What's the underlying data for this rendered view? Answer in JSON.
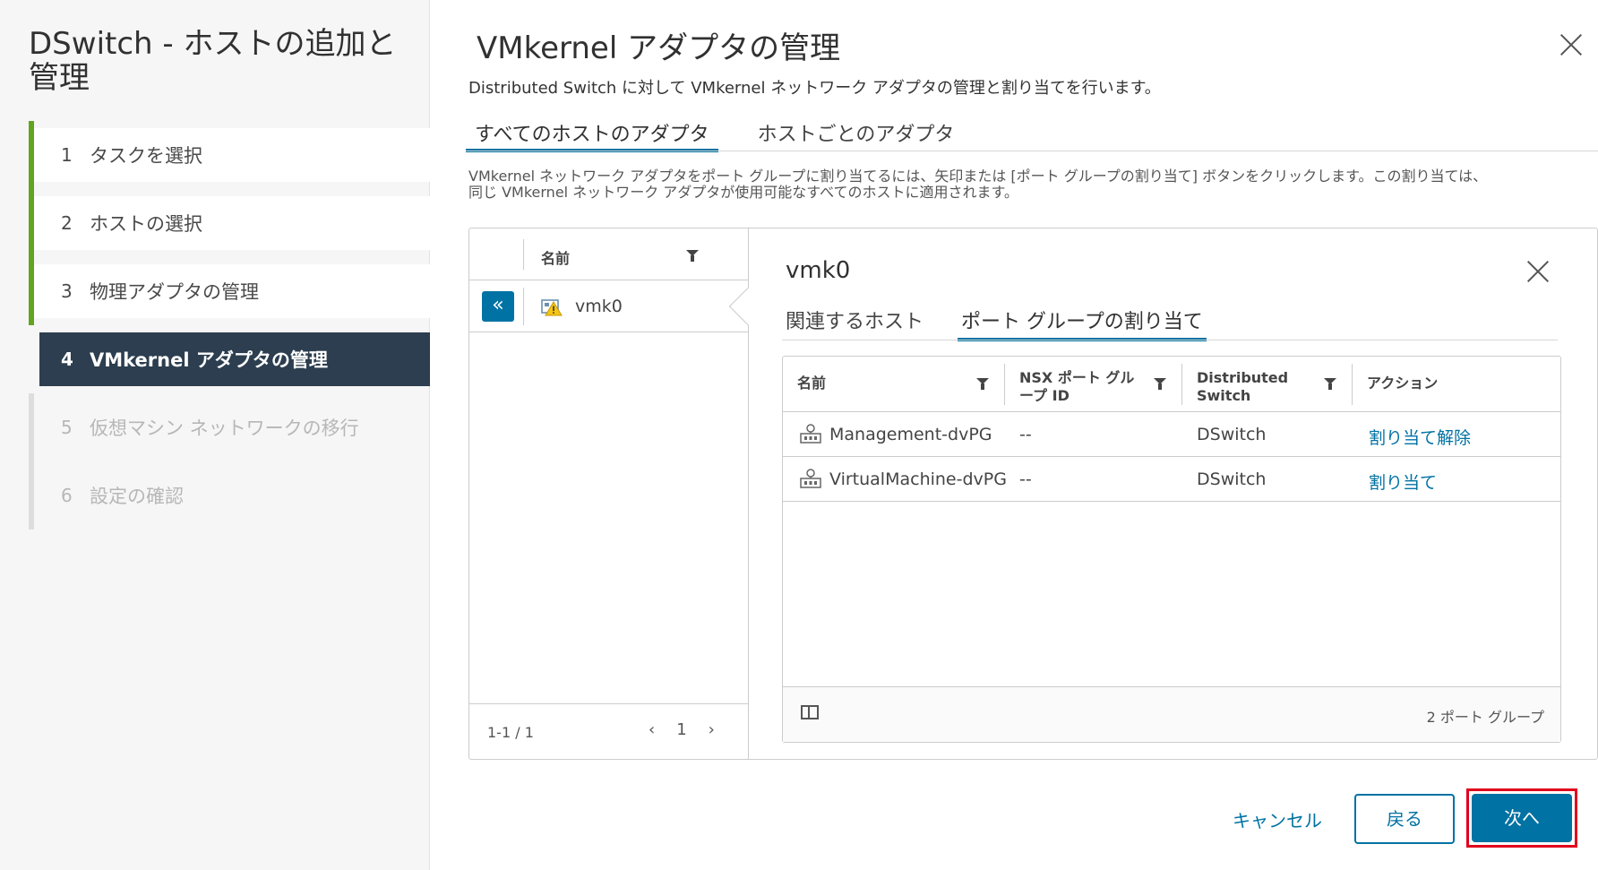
{
  "wizard": {
    "title": "DSwitch - ホストの追加と管理",
    "steps": [
      {
        "num": "1",
        "label": "タスクを選択",
        "state": "done"
      },
      {
        "num": "2",
        "label": "ホストの選択",
        "state": "done"
      },
      {
        "num": "3",
        "label": "物理アダプタの管理",
        "state": "done"
      },
      {
        "num": "4",
        "label": "VMkernel アダプタの管理",
        "state": "active"
      },
      {
        "num": "5",
        "label": "仮想マシン ネットワークの移行",
        "state": "disabled"
      },
      {
        "num": "6",
        "label": "設定の確認",
        "state": "disabled"
      }
    ]
  },
  "main": {
    "title": "VMkernel アダプタの管理",
    "description": "Distributed Switch に対して VMkernel ネットワーク アダプタの管理と割り当てを行います。",
    "tabs": [
      "すべてのホストのアダプタ",
      "ホストごとのアダプタ"
    ],
    "help_line1": "VMkernel ネットワーク アダプタをポート グループに割り当てるには、矢印または [ポート グループの割り当て] ボタンをクリックします。この割り当ては、",
    "help_line2": "同じ VMkernel ネットワーク アダプタが使用可能なすべてのホストに適用されます。"
  },
  "list": {
    "column_name": "名前",
    "collapse_glyph": "«",
    "rows": [
      {
        "name": "vmk0"
      }
    ],
    "range": "1-1 / 1",
    "page": "1",
    "prev": "‹",
    "next": "›"
  },
  "detail": {
    "title": "vmk0",
    "tabs": [
      "関連するホスト",
      "ポート グループの割り当て"
    ],
    "columns": [
      "名前",
      "NSX ポート グループ ID",
      "Distributed Switch",
      "アクション"
    ],
    "rows": [
      {
        "name": "Management-dvPG",
        "nsx_id": "--",
        "switch": "DSwitch",
        "action": "割り当て解除"
      },
      {
        "name": "VirtualMachine-dvPG",
        "nsx_id": "--",
        "switch": "DSwitch",
        "action": "割り当て"
      }
    ],
    "footer_count": "2 ポート グループ"
  },
  "footer": {
    "cancel": "キャンセル",
    "back": "戻る",
    "next": "次へ"
  },
  "colors": {
    "accent": "#0072a3",
    "step_done": "#62a420",
    "active_step_bg": "#2c3e4f",
    "highlight": "#e0001b"
  },
  "icons": [
    "close-icon",
    "filter-icon",
    "double-chevron-left-icon",
    "vmkernel-adapter-warning-icon",
    "port-group-icon",
    "column-toggle-icon"
  ]
}
